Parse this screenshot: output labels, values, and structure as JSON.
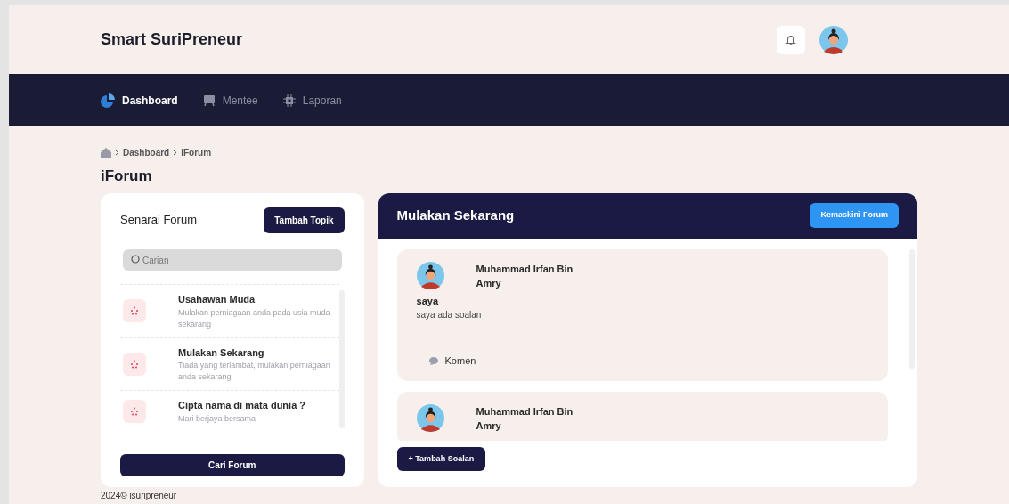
{
  "header": {
    "title": "Smart SuriPreneur"
  },
  "nav": [
    {
      "label": "Dashboard",
      "selected": true,
      "kind": "pie"
    },
    {
      "label": "Mentee",
      "selected": false,
      "kind": "board"
    },
    {
      "label": "Laporan",
      "selected": false,
      "kind": "chip"
    }
  ],
  "breadcrumb": [
    "Dashboard",
    "iForum"
  ],
  "page_title": "iForum",
  "forum_list": {
    "title": "Senarai Forum",
    "add_button": "Tambah Topik",
    "search": {
      "placeholder": "Carian"
    },
    "items": [
      {
        "title": "Usahawan Muda",
        "description": "Mulakan perniagaan anda pada usia muda sekarang"
      },
      {
        "title": "Mulakan Sekarang",
        "description": "Tiada yang terlambat, mulakan perniagaan anda sekarang"
      },
      {
        "title": "Cipta nama di mata dunia ?",
        "description": "Mari berjaya bersama"
      }
    ],
    "search_button": "Cari Forum"
  },
  "forum": {
    "title": "Mulakan Sekarang",
    "update_button": "Kemaskini Forum",
    "posts": [
      {
        "author": "Muhammad Irfan Bin Amry",
        "subject": "saya",
        "body": "saya ada soalan",
        "comment_button": "Komen"
      },
      {
        "author": "Muhammad Irfan Bin Amry"
      }
    ],
    "add_button": "+ Tambah Soalan"
  },
  "footer": "2024© isuripreneur"
}
